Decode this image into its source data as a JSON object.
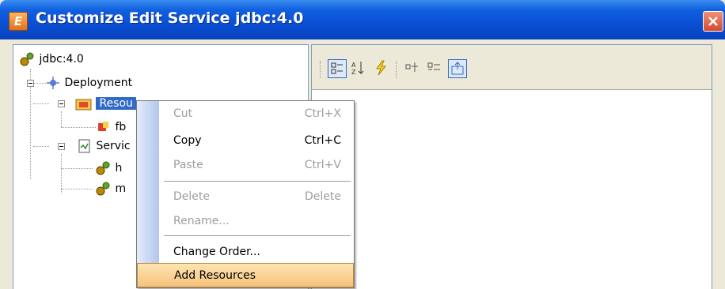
{
  "window": {
    "title": "Customize Edit Service jdbc:4.0"
  },
  "tree": {
    "root": "jdbc:4.0",
    "deployment": "Deployment",
    "resources": "Resou",
    "resource_child": "fb",
    "services": "Servic",
    "service_child_1": "h",
    "service_child_2": "m"
  },
  "context_menu": {
    "items": [
      {
        "label": "Cut",
        "shortcut": "Ctrl+X",
        "enabled": false
      },
      {
        "label": "Copy",
        "shortcut": "Ctrl+C",
        "enabled": true
      },
      {
        "label": "Paste",
        "shortcut": "Ctrl+V",
        "enabled": false
      },
      {
        "label": "Delete",
        "shortcut": "Delete",
        "enabled": false
      },
      {
        "label": "Rename...",
        "shortcut": "",
        "enabled": false
      },
      {
        "label": "Change Order...",
        "shortcut": "",
        "enabled": true
      },
      {
        "label": "Add Resources",
        "shortcut": "",
        "enabled": true,
        "highlighted": true
      }
    ]
  },
  "toolbar_icons": [
    "categorized-icon",
    "sort-alpha-icon",
    "events-icon",
    "expand-icon",
    "collapse-icon",
    "show-description-icon"
  ],
  "colors": {
    "title_bar": "#0a4fd4",
    "selection": "#316ac5",
    "menu_highlight": "#f6c27b"
  }
}
